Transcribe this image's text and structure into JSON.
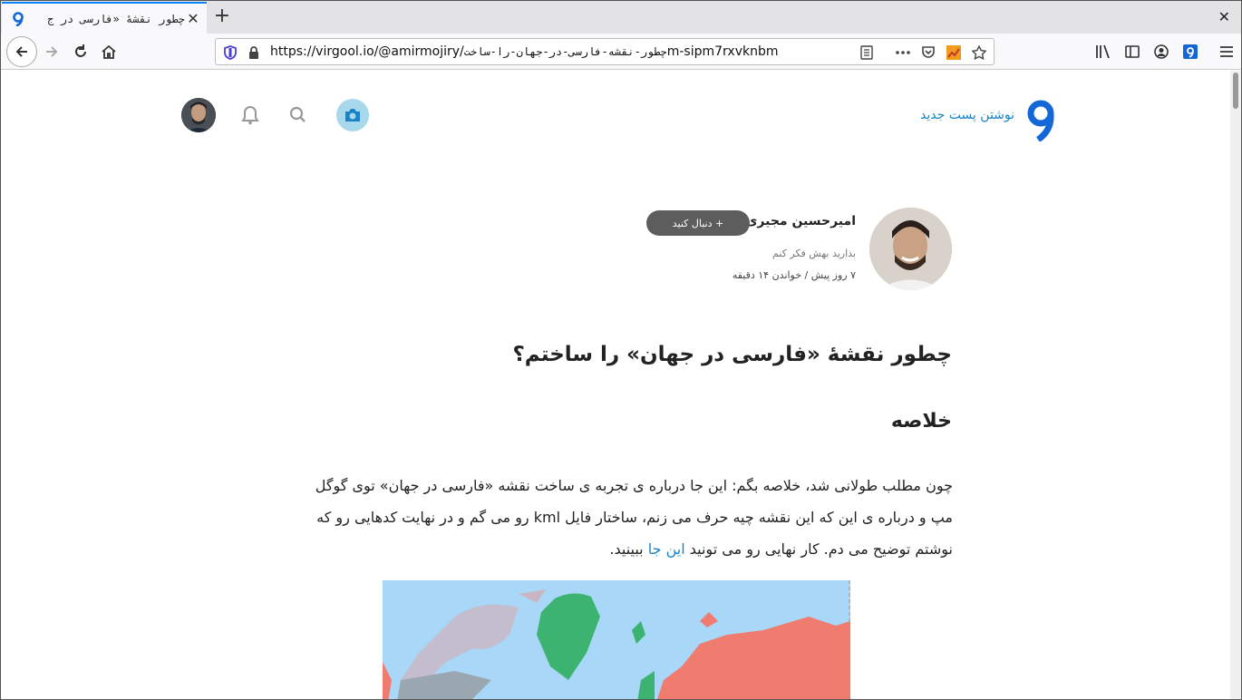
{
  "browser": {
    "tab_title": "چطور نقشهٔ «فارسی در ج",
    "url_host": "https://virgool.io/@amirmojiry/",
    "url_path": "چطور-نقشه-فارسی-در-جهان-را-ساخت",
    "url_suffix": "m-sipm7rxvknbm",
    "icons": {
      "back": "back-arrow-icon",
      "forward": "forward-arrow-icon",
      "reload": "reload-icon",
      "home": "home-icon",
      "close": "close-icon",
      "new_tab": "plus-icon"
    }
  },
  "site": {
    "new_post_label": "نوشتن پست جدید",
    "accent_color": "#1a83c5"
  },
  "author": {
    "name": "امیرحسین مجیری",
    "follow_label": "+  دنبال کنید",
    "bio": "بذارید بهش فکر کنم",
    "meta": "۷ روز پیش / خواندن ۱۴ دقیقه"
  },
  "post": {
    "title": "چطور نقشهٔ «فارسی در جهان» را ساختم؟",
    "section_heading": "خلاصه",
    "summary_text": "چون مطلب طولانی شد، خلاصه بگم: این جا درباره ی تجربه ی ساخت نقشه «فارسی در جهان» توی گوگل مپ و درباره ی این که این نقشه چیه حرف می زنم، ساختار فایل kml رو می گم و در نهایت کدهایی رو که نوشتم توضیح می دم. کار نهایی رو می تونید",
    "summary_link": "این جا",
    "summary_end": "ببینید."
  }
}
